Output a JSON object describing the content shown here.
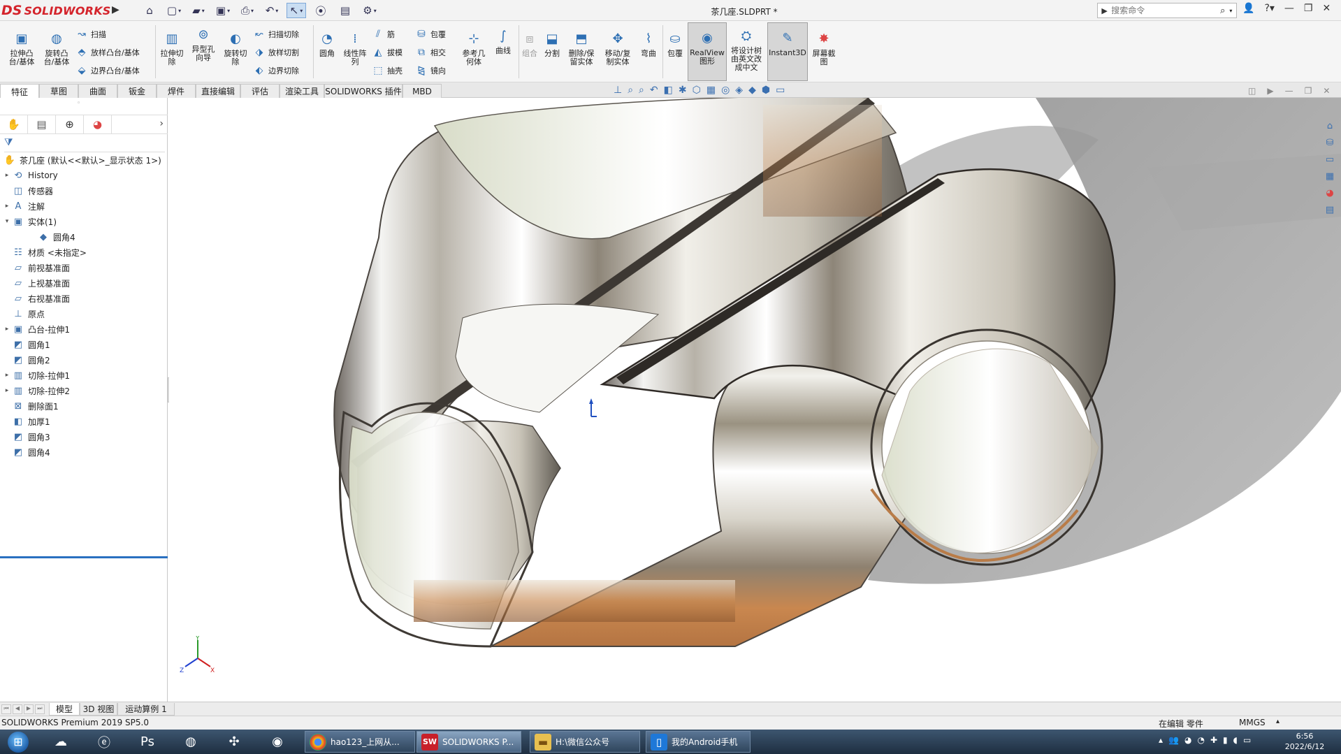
{
  "titlebar": {
    "brand_ds": "DS",
    "brand_name": "SOLIDWORKS",
    "doc_title": "茶几座.SLDPRT *",
    "search_placeholder": "搜索命令",
    "quick_access": [
      "home-icon",
      "new-doc-icon",
      "open-folder-icon",
      "save-icon",
      "print-icon",
      "undo-icon",
      "select-pointer-icon",
      "traffic-light-icon",
      "file-properties-icon",
      "options-gear-icon"
    ]
  },
  "ribbon": {
    "extrude_boss": "拉伸凸\n台/基体",
    "revolve_boss": "旋转凸\n台/基体",
    "sweep": "扫描",
    "loft_boss": "放样凸台/基体",
    "boundary_boss": "边界凸台/基体",
    "extrude_cut": "拉伸切\n除",
    "hole_wizard": "异型孔\n向导",
    "revolve_cut": "旋转切\n除",
    "sweep_cut": "扫描切除",
    "loft_cut": "放样切割",
    "boundary_cut": "边界切除",
    "fillet": "圆角",
    "linear_pattern": "线性阵\n列",
    "rib": "筋",
    "draft": "拔模",
    "shell": "抽壳",
    "wrap": "包覆",
    "intersect": "相交",
    "mirror": "镜向",
    "ref_geometry": "参考几\n何体",
    "curves": "曲线",
    "combine": "组合",
    "split": "分割",
    "delete_keep_body": "删除/保\n留实体",
    "move_copy_body": "移动/复\n制实体",
    "flex": "弯曲",
    "wrap2": "包覆",
    "realview": "RealView\n图形",
    "translate_tree": "将设计树\n由英文改\n成中文",
    "instant3d": "Instant3D",
    "screen_capture": "屏幕截\n图"
  },
  "tabs": [
    "特征",
    "草图",
    "曲面",
    "钣金",
    "焊件",
    "直接编辑",
    "评估",
    "渲染工具",
    "SOLIDWORKS 插件",
    "MBD"
  ],
  "active_tab": 0,
  "tree": {
    "root": "茶几座  (默认<<默认>_显示状态 1>)",
    "items": [
      {
        "label": "History",
        "icon": "history-icon",
        "expand": "▸",
        "indent": 0
      },
      {
        "label": "传感器",
        "icon": "sensor-icon",
        "expand": "",
        "indent": 0
      },
      {
        "label": "注解",
        "icon": "annotation-icon",
        "expand": "▸",
        "indent": 0
      },
      {
        "label": "实体(1)",
        "icon": "solid-bodies-icon",
        "expand": "▾",
        "indent": 0
      },
      {
        "label": "圆角4",
        "icon": "body-icon",
        "expand": "",
        "indent": 1
      },
      {
        "label": "材质 <未指定>",
        "icon": "material-icon",
        "expand": "",
        "indent": 0
      },
      {
        "label": "前视基准面",
        "icon": "plane-icon",
        "expand": "",
        "indent": 0
      },
      {
        "label": "上视基准面",
        "icon": "plane-icon",
        "expand": "",
        "indent": 0
      },
      {
        "label": "右视基准面",
        "icon": "plane-icon",
        "expand": "",
        "indent": 0
      },
      {
        "label": "原点",
        "icon": "origin-icon",
        "expand": "",
        "indent": 0
      },
      {
        "label": "凸台-拉伸1",
        "icon": "extrude-feature-icon",
        "expand": "▸",
        "indent": 0
      },
      {
        "label": "圆角1",
        "icon": "fillet-feature-icon",
        "expand": "",
        "indent": 0
      },
      {
        "label": "圆角2",
        "icon": "fillet-feature-icon",
        "expand": "",
        "indent": 0
      },
      {
        "label": "切除-拉伸1",
        "icon": "cut-feature-icon",
        "expand": "▸",
        "indent": 0
      },
      {
        "label": "切除-拉伸2",
        "icon": "cut-feature-icon",
        "expand": "▸",
        "indent": 0
      },
      {
        "label": "删除面1",
        "icon": "delete-face-icon",
        "expand": "",
        "indent": 0
      },
      {
        "label": "加厚1",
        "icon": "thicken-icon",
        "expand": "",
        "indent": 0
      },
      {
        "label": "圆角3",
        "icon": "fillet-feature-icon",
        "expand": "",
        "indent": 0
      },
      {
        "label": "圆角4",
        "icon": "fillet-feature-icon",
        "expand": "",
        "indent": 0
      }
    ]
  },
  "bottom_tabs": [
    "模型",
    "3D 视图",
    "运动算例 1"
  ],
  "status": {
    "product": "SOLIDWORKS Premium 2019 SP5.0",
    "editing": "在编辑 零件",
    "units": "MMGS"
  },
  "taskbar": {
    "apps": [
      {
        "label": "hao123_上网从...",
        "icon": "chrome-icon"
      },
      {
        "label": "SOLIDWORKS P...",
        "icon": "solidworks-icon"
      },
      {
        "label": "H:\\微信公众号",
        "icon": "folder-icon"
      },
      {
        "label": "我的Android手机",
        "icon": "phone-icon"
      }
    ],
    "time": "6:56",
    "date": "2022/6/12"
  },
  "colors": {
    "brand_red": "#d4232b",
    "accent_blue": "#2a70c0",
    "taskbar": "#2a3f55"
  }
}
